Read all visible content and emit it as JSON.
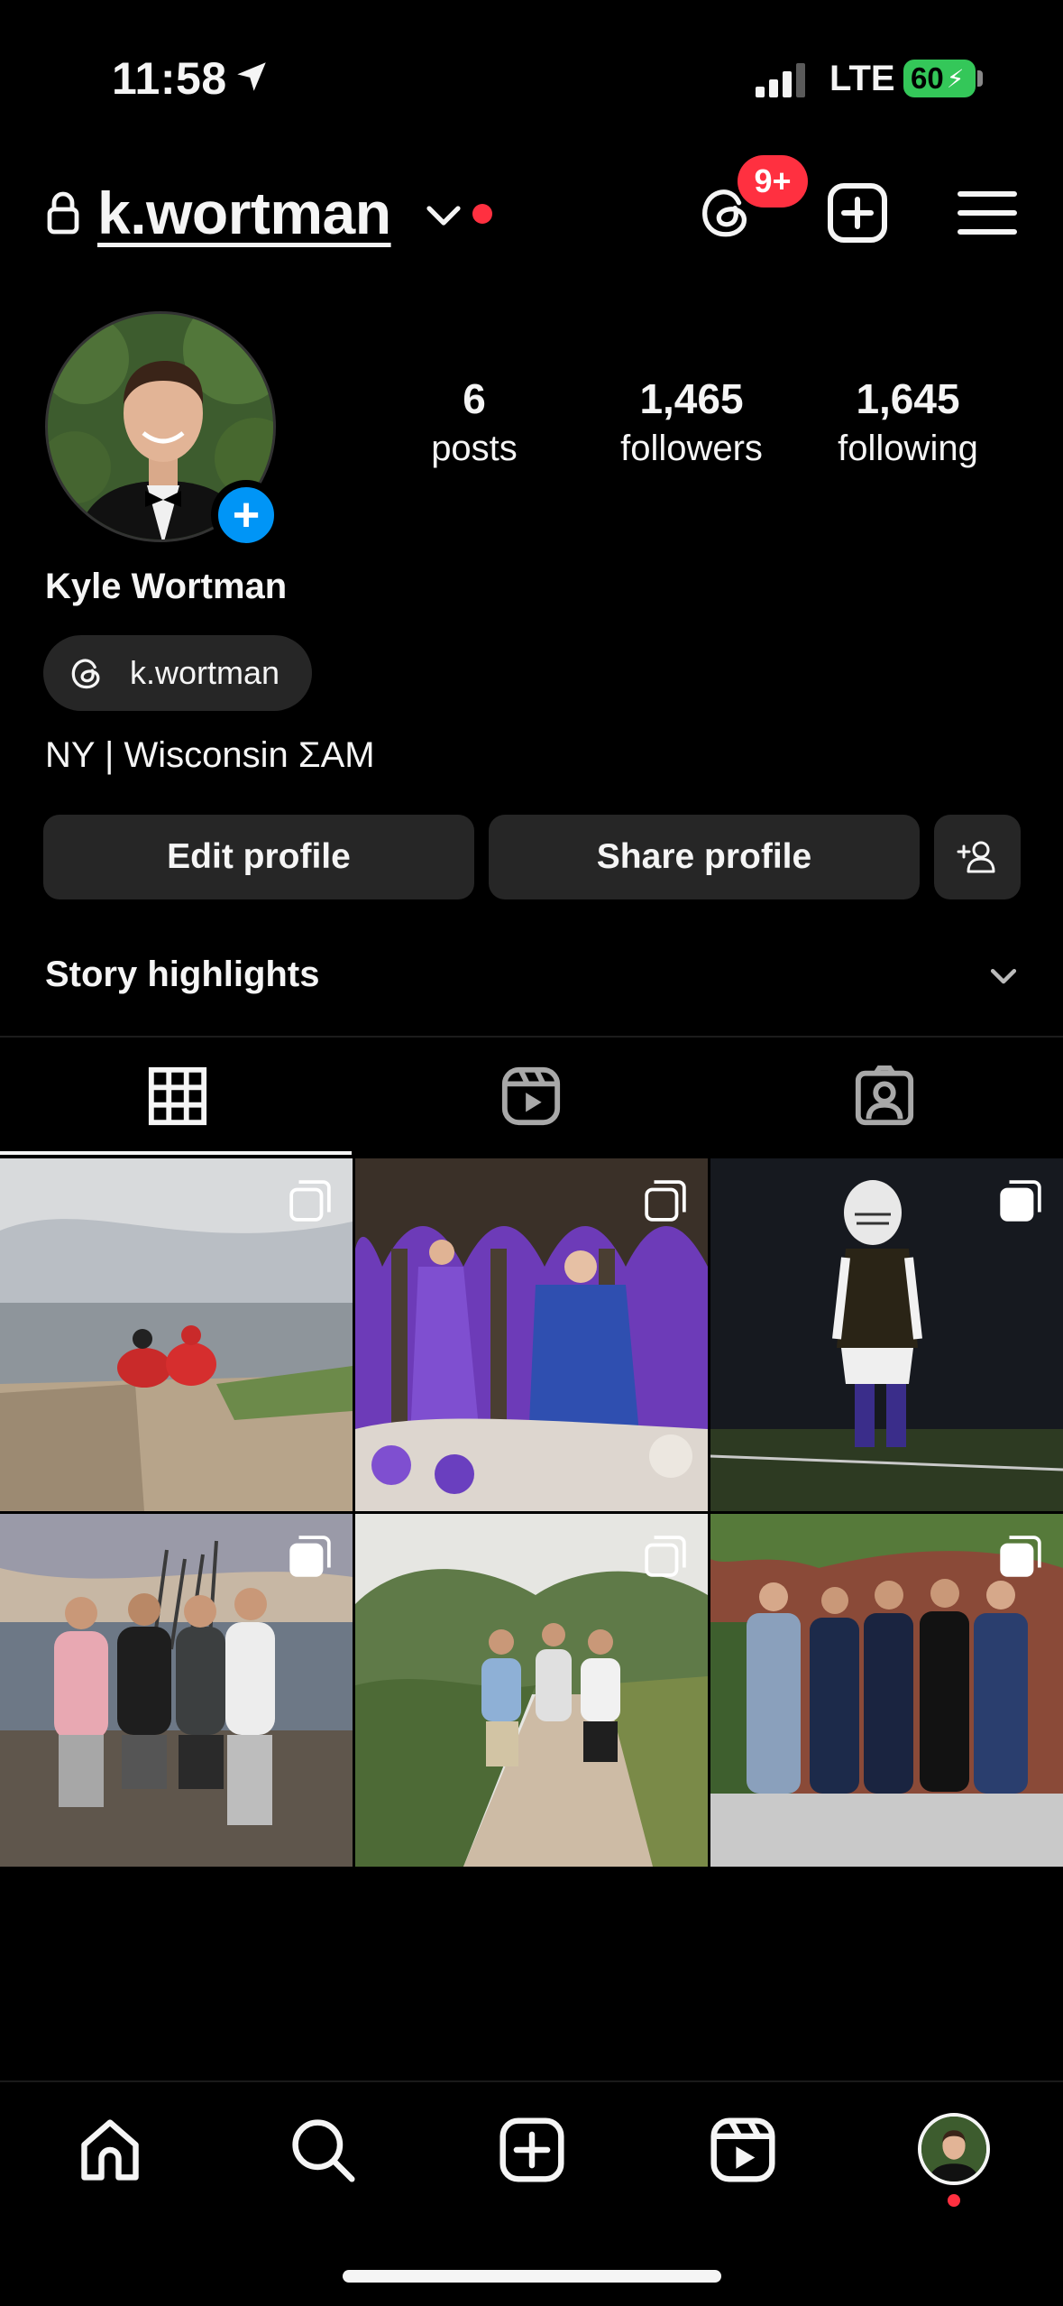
{
  "status_bar": {
    "time": "11:58",
    "network": "LTE",
    "battery": "60"
  },
  "header": {
    "username": "k.wortman",
    "notifications_badge": "9+"
  },
  "profile": {
    "stats": [
      {
        "value": "6",
        "label": "posts"
      },
      {
        "value": "1,465",
        "label": "followers"
      },
      {
        "value": "1,645",
        "label": "following"
      }
    ],
    "full_name": "Kyle Wortman",
    "threads_handle": "k.wortman",
    "bio": "NY | Wisconsin ΣΑΜ"
  },
  "buttons": {
    "edit": "Edit profile",
    "share": "Share profile"
  },
  "highlights": {
    "title": "Story highlights"
  },
  "tabs": [
    "grid-icon",
    "reels-icon",
    "tagged-icon"
  ],
  "grid": [
    {
      "name": "post-1",
      "multi": true
    },
    {
      "name": "post-2",
      "multi": true
    },
    {
      "name": "post-3",
      "multi": true
    },
    {
      "name": "post-4",
      "multi": true
    },
    {
      "name": "post-5",
      "multi": true
    },
    {
      "name": "post-6",
      "multi": true
    }
  ],
  "bottom_nav": [
    "home-icon",
    "search-icon",
    "create-icon",
    "reels-icon",
    "profile-avatar"
  ],
  "colors": {
    "accent": "#0095f6",
    "notification": "#ff3040",
    "battery": "#34c759",
    "button_bg": "#262626"
  }
}
